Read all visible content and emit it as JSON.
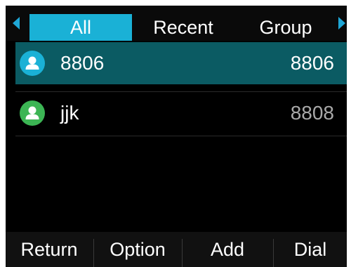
{
  "tabs": [
    {
      "label": "All",
      "active": true
    },
    {
      "label": "Recent",
      "active": false
    },
    {
      "label": "Group",
      "active": false
    }
  ],
  "nav_icons": {
    "left": "triangle-left-icon",
    "right": "triangle-right-icon"
  },
  "contacts": [
    {
      "name": "8806",
      "number": "8806",
      "selected": true,
      "avatar_color": "#1ab1d6",
      "icon": "contact-person-icon"
    },
    {
      "name": "jjk",
      "number": "8808",
      "selected": false,
      "avatar_color": "#3cb554",
      "icon": "contact-person-icon"
    }
  ],
  "softkeys": {
    "return_label": "Return",
    "option_label": "Option",
    "add_label": "Add",
    "dial_label": "Dial"
  },
  "colors": {
    "accent": "#1ab1d6",
    "selected_row": "#0b5b63",
    "background": "#000000"
  }
}
